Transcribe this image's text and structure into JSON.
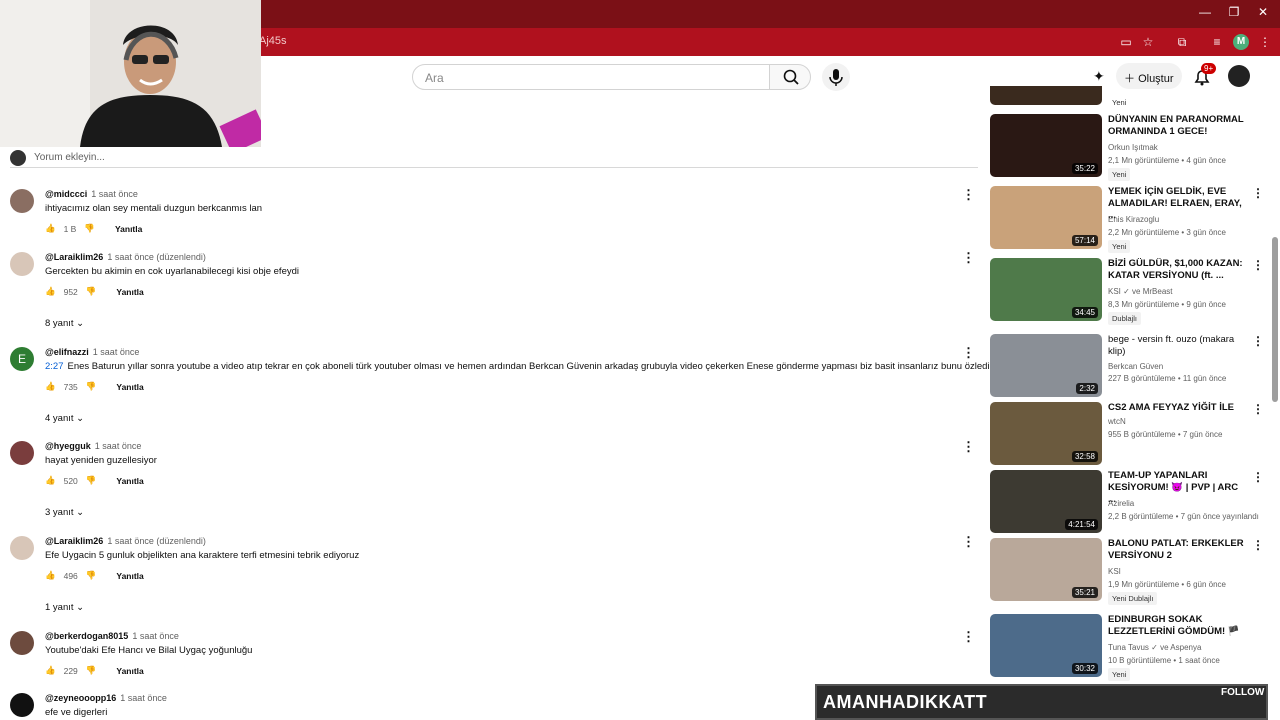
{
  "browser": {
    "url_fragment": "Aj45s",
    "profile_initial": "M"
  },
  "header": {
    "search_placeholder": "Ara",
    "create_label": "Oluştur",
    "notif_count": "9+"
  },
  "add_comment": {
    "placeholder": "Yorum ekleyin..."
  },
  "comments": [
    {
      "user": "@midccci",
      "time": "1 saat önce",
      "text": "ihtiyacımız olan sey mentali duzgun berkcanmıs lan",
      "likes": "1 B",
      "reply": "Yanıtla"
    },
    {
      "user": "@Laraiklim26",
      "time": "1 saat önce (düzenlendi)",
      "text": "Gercekten bu akimin en cok uyarlanabilecegi kisi obje efeydi",
      "likes": "952",
      "reply": "Yanıtla",
      "replies": "8 yanıt"
    },
    {
      "user": "@elifnazzi",
      "time": "1 saat önce",
      "timestamp": "2:27",
      "text": "Enes Baturun yıllar sonra youtube a video atıp tekrar en çok aboneli türk youtuber olması ve hemen ardından Berkcan Güvenin arkadaş grubuyla video çekerken Enese göndermе yapması biz basit insanlarız bunu özledik",
      "likes": "735",
      "reply": "Yanıtla",
      "replies": "4 yanıt",
      "avatar_letter": "E"
    },
    {
      "user": "@hyegguk",
      "time": "1 saat önce",
      "text": "hayat yeniden guzellesiyor",
      "likes": "520",
      "reply": "Yanıtla",
      "replies": "3 yanıt"
    },
    {
      "user": "@Laraiklim26",
      "time": "1 saat önce (düzenlendi)",
      "text": "Efe Uygacin 5 gunluk objelikten ana karaktere terfi etmesini tebrik ediyoruz",
      "likes": "496",
      "reply": "Yanıtla",
      "replies": "1 yanıt"
    },
    {
      "user": "@berkerdogan8015",
      "time": "1 saat önce",
      "text": "Youtube'daki Efe Hancı ve Bilal Uygaç yoğunluğu",
      "likes": "229",
      "reply": "Yanıtla"
    },
    {
      "user": "@zeyneooopp16",
      "time": "1 saat önce",
      "text": "efe ve digerleri"
    }
  ],
  "sidebar": {
    "top_badge": "Yeni",
    "videos": [
      {
        "title": "DÜNYANIN EN PARANORMAL ORMANINDA 1 GECE!",
        "channel": "Orkun Işıtmak",
        "stats": "2,1 Mn görüntüleme • 4 gün önce",
        "badge": "Yeni",
        "duration": "35:22"
      },
      {
        "title": "YEMEK İÇİN GELDİK, EVE ALMADILAR! ELRAEN, ERAY, ...",
        "channel": "Enis Kirazoglu",
        "stats": "2,2 Mn görüntüleme • 3 gün önce",
        "badge": "Yeni",
        "duration": "57:14"
      },
      {
        "title": "BİZİ GÜLDÜR, $1,000 KAZAN: KATAR VERSİYONU (ft. ...",
        "channel": "KSI ✓ ve MrBeast",
        "stats": "8,3 Mn görüntüleme • 9 gün önce",
        "badge": "Dublajlı",
        "duration": "34:45"
      },
      {
        "title": "bege - versin ft. ouzo (makara klip)",
        "channel": "Berkcan Güven",
        "stats": "227 B görüntüleme • 11 gün önce",
        "duration": "2:32"
      },
      {
        "title": "CS2 AMA FEYYAZ YİĞİT İLE",
        "channel": "wtcN",
        "stats": "955 B görüntüleme • 7 gün önce",
        "duration": "32:58"
      },
      {
        "title": "TEAM-UP YAPANLARI KESİYORUM! 😈 | PVP | ARC ...",
        "channel": "Azirelia",
        "stats": "2,2 B görüntüleme • 7 gün önce yayınlandı",
        "duration": "4:21:54"
      },
      {
        "title": "BALONU PATLAT: ERKEKLER VERSİYONU 2",
        "channel": "KSI",
        "stats": "1,9 Mn görüntüleme • 6 gün önce",
        "badge": "Yeni  Dublajlı",
        "duration": "35:21"
      },
      {
        "title": "EDINBURGH SOKAK LEZZETLERİNİ GÖMDÜM! 🏴",
        "channel": "Tuna Tavus ✓ ve Aspenya",
        "stats": "10 B görüntüleme • 1 saat önce",
        "badge": "Yeni",
        "duration": "30:32"
      }
    ]
  },
  "overlay": {
    "text": "AMANHADIKKATT",
    "follow": "FOLLOW"
  },
  "colors": {
    "titlebar": "#7b1016",
    "tabbar": "#b0111e",
    "link": "#065fd4"
  }
}
